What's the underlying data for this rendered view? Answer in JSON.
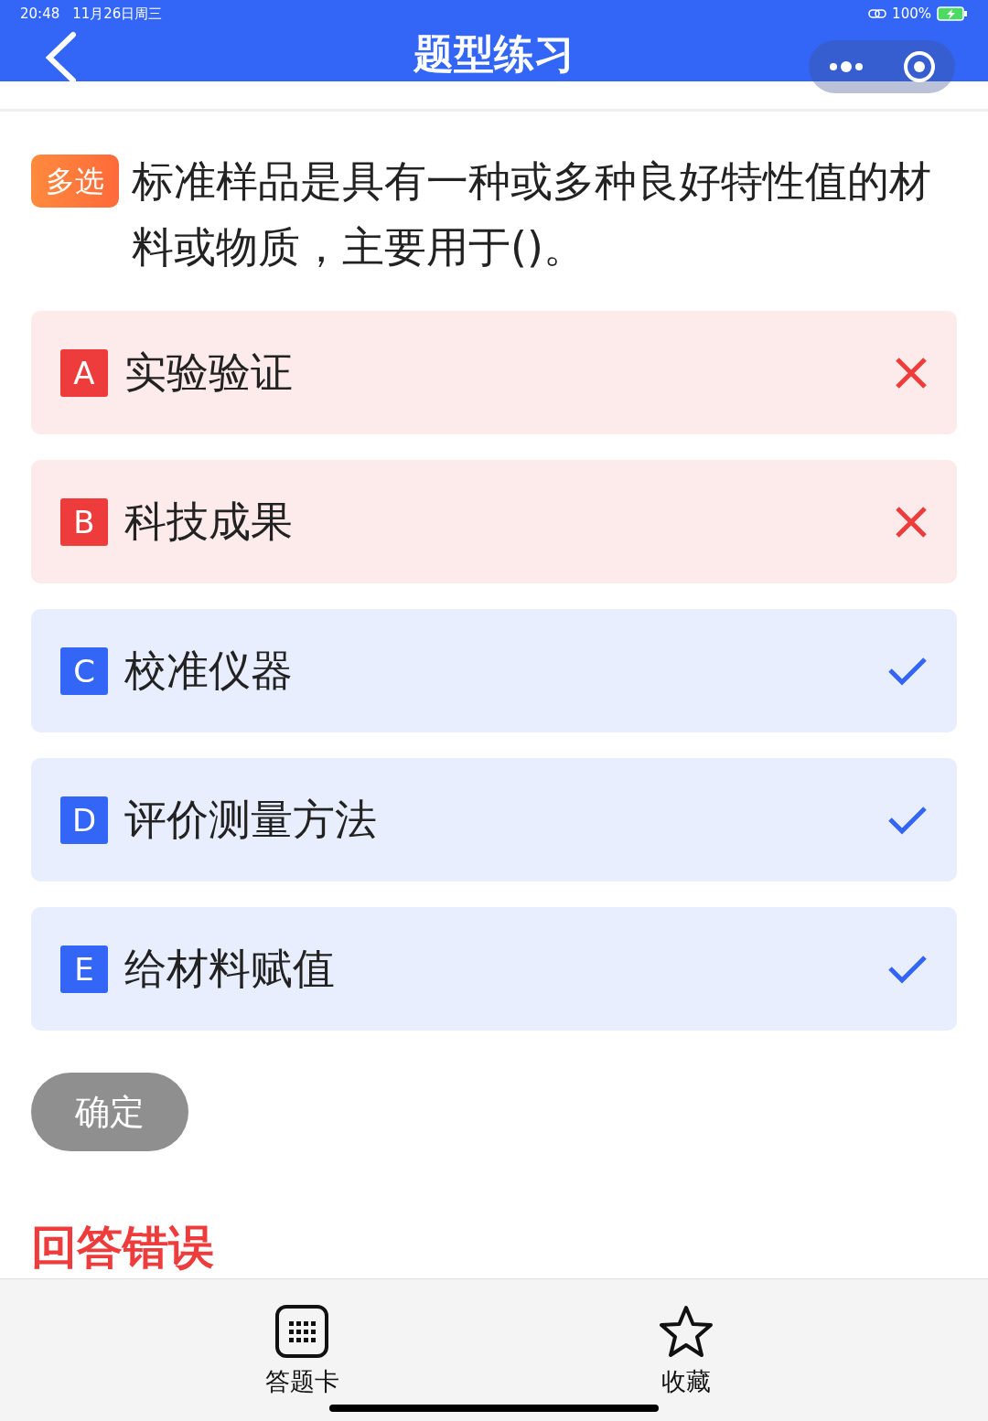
{
  "status_bar": {
    "time": "20:48",
    "date": "11月26日周三",
    "battery": "100%"
  },
  "nav": {
    "title": "题型练习"
  },
  "question": {
    "tag": "多选",
    "text": "标准样品是具有一种或多种良好特性值的材料或物质，主要用于()。"
  },
  "options": [
    {
      "letter": "A",
      "text": "实验验证",
      "kind": "wrong"
    },
    {
      "letter": "B",
      "text": "科技成果",
      "kind": "wrong"
    },
    {
      "letter": "C",
      "text": "校准仪器",
      "kind": "correct"
    },
    {
      "letter": "D",
      "text": "评价测量方法",
      "kind": "correct"
    },
    {
      "letter": "E",
      "text": "给材料赋值",
      "kind": "correct"
    }
  ],
  "confirm_button": {
    "label": "确定",
    "disabled": true
  },
  "result": "回答错误",
  "bottom_bar": [
    {
      "label": "答题卡",
      "kind": "card"
    },
    {
      "label": "收藏",
      "kind": "star"
    }
  ]
}
